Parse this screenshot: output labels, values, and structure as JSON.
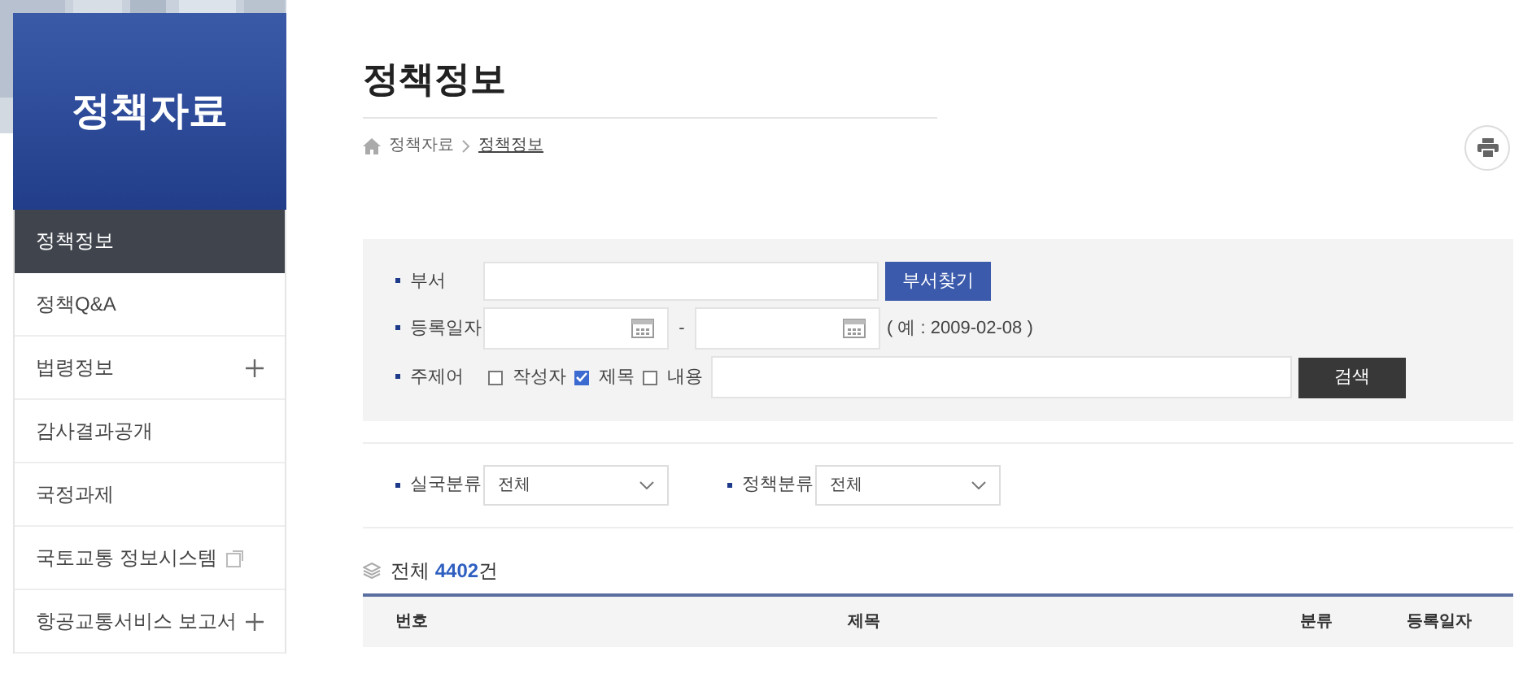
{
  "sidebar": {
    "title": "정책자료",
    "items": [
      {
        "label": "정책정보",
        "selected": true,
        "kind": "plain"
      },
      {
        "label": "정책Q&A",
        "selected": false,
        "kind": "plain"
      },
      {
        "label": "법령정보",
        "selected": false,
        "kind": "expand"
      },
      {
        "label": "감사결과공개",
        "selected": false,
        "kind": "plain"
      },
      {
        "label": "국정과제",
        "selected": false,
        "kind": "plain"
      },
      {
        "label": "국토교통 정보시스템",
        "selected": false,
        "kind": "external"
      },
      {
        "label": "항공교통서비스 보고서",
        "selected": false,
        "kind": "expand"
      }
    ]
  },
  "page_title": "정책정보",
  "breadcrumb": [
    "정책자료",
    "정책정보"
  ],
  "search": {
    "department": {
      "label": "부서",
      "button": "부서찾기"
    },
    "date": {
      "label": "등록일자",
      "separator": "-",
      "example": "( 예 : 2009-02-08 )"
    },
    "keyword": {
      "label": "주제어",
      "options": [
        {
          "label": "작성자",
          "checked": false
        },
        {
          "label": "제목",
          "checked": true
        },
        {
          "label": "내용",
          "checked": false
        }
      ],
      "button": "검색"
    }
  },
  "filters": [
    {
      "label": "실국분류",
      "value": "전체"
    },
    {
      "label": "정책분류",
      "value": "전체"
    }
  ],
  "total": {
    "prefix": "전체",
    "count": "4402",
    "suffix": "건"
  },
  "table": {
    "columns": [
      "번호",
      "제목",
      "분류",
      "등록일자"
    ]
  }
}
